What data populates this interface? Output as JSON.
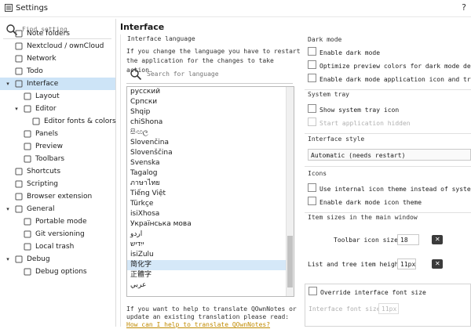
{
  "window": {
    "title": "Settings",
    "help": "?"
  },
  "sidebar": {
    "search_placeholder": "Find setting",
    "items": [
      {
        "label": "Note folders",
        "icon": "folder-icon"
      },
      {
        "label": "Nextcloud / ownCloud",
        "icon": "cloud-icon"
      },
      {
        "label": "Network",
        "icon": "network-icon"
      },
      {
        "label": "Todo",
        "icon": "todo-icon"
      },
      {
        "label": "Interface",
        "icon": "interface-icon"
      },
      {
        "label": "Layout",
        "icon": "layout-icon"
      },
      {
        "label": "Editor",
        "icon": "editor-icon"
      },
      {
        "label": "Editor fonts & colors",
        "icon": "font-icon"
      },
      {
        "label": "Panels",
        "icon": "panels-icon"
      },
      {
        "label": "Preview",
        "icon": "preview-icon"
      },
      {
        "label": "Toolbars",
        "icon": "toolbars-icon"
      },
      {
        "label": "Shortcuts",
        "icon": "shortcuts-icon"
      },
      {
        "label": "Scripting",
        "icon": "scripting-icon"
      },
      {
        "label": "Browser extension",
        "icon": "browser-icon"
      },
      {
        "label": "General",
        "icon": "general-icon"
      },
      {
        "label": "Portable mode",
        "icon": "portable-icon"
      },
      {
        "label": "Git versioning",
        "icon": "git-icon"
      },
      {
        "label": "Local trash",
        "icon": "trash-icon"
      },
      {
        "label": "Debug",
        "icon": "debug-icon"
      },
      {
        "label": "Debug options",
        "icon": "debug-options-icon"
      }
    ]
  },
  "main": {
    "heading": "Interface",
    "language": {
      "group_label": "Interface language",
      "description": "If you change the language you have to restart the application for the changes to take action.",
      "search_placeholder": "Search for language",
      "items": [
        "русский",
        "Српски",
        "Shqip",
        "chiShona",
        "සිංහල",
        "Slovenčina",
        "Slovenščina",
        "Svenska",
        "Tagalog",
        "ภาษาไทย",
        "Tiếng Việt",
        "Türkçe",
        "isiXhosa",
        "Українська мова",
        "اردو",
        "ייִדיש",
        "isiZulu",
        "简化字",
        "正體字",
        "عربي"
      ],
      "selected": "简化字",
      "footer_text": "If you want to help to translate QOwnNotes or update an existing translation please read:",
      "footer_link": "How can I help to translate QOwnNotes?"
    },
    "dark_mode": {
      "title": "Dark mode",
      "options": [
        "Enable dark mode",
        "Optimize preview colors for dark mode desktop themes",
        "Enable dark mode application icon and tray icon"
      ]
    },
    "system_tray": {
      "title": "System tray",
      "options": [
        "Show system tray icon",
        "Start application hidden"
      ]
    },
    "interface_style": {
      "title": "Interface style",
      "value": "Automatic (needs restart)"
    },
    "icons": {
      "title": "Icons",
      "options": [
        "Use internal icon theme instead of system icon theme",
        "Enable dark mode icon theme"
      ]
    },
    "item_sizes": {
      "title": "Item sizes in the main window",
      "toolbar_label": "Toolbar icon size:",
      "toolbar_value": "18",
      "list_label": "List and tree item height:",
      "list_value": "11px"
    },
    "font": {
      "override_label": "Override interface font size",
      "size_label": "Interface font size:",
      "size_value": "11px"
    }
  }
}
